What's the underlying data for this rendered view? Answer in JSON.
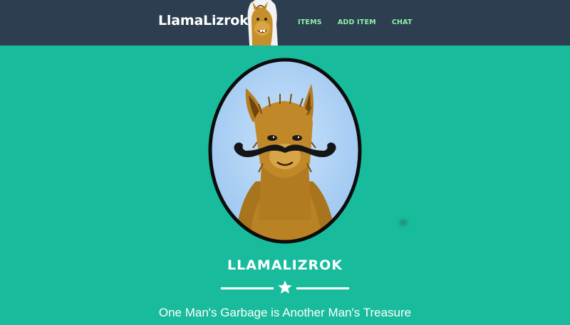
{
  "navbar": {
    "brand": "LlamaLizrok",
    "logo_icon": "llama-head-icon",
    "links": [
      {
        "label": "ITEMS"
      },
      {
        "label": "ADD ITEM"
      },
      {
        "label": "CHAT"
      }
    ]
  },
  "hero": {
    "portrait_icon": "mustache-llama-portrait",
    "title": "LLAMALIZROK",
    "divider_icon": "star-icon",
    "tagline": "One Man's Garbage is Another Man's Treasure"
  },
  "colors": {
    "navbar_bg": "#2c3e50",
    "page_bg": "#18bc9c",
    "nav_link": "#8ff0a8",
    "text": "#ffffff"
  }
}
